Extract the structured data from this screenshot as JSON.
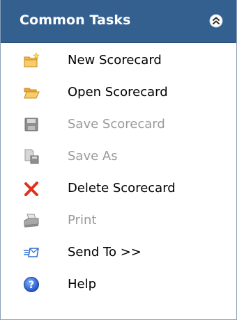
{
  "panel": {
    "title": "Common Tasks",
    "collapse_icon": "double-chevron-up-icon",
    "colors": {
      "header_bg": "#34608f",
      "header_text": "#ffffff",
      "enabled_text": "#000000",
      "disabled_text": "#9a9a9a"
    }
  },
  "tasks": [
    {
      "label": "New Scorecard",
      "icon": "new-folder-icon",
      "enabled": true
    },
    {
      "label": "Open Scorecard",
      "icon": "open-folder-icon",
      "enabled": true
    },
    {
      "label": "Save Scorecard",
      "icon": "save-disk-icon",
      "enabled": false
    },
    {
      "label": "Save As",
      "icon": "save-as-icon",
      "enabled": false
    },
    {
      "label": "Delete Scorecard",
      "icon": "delete-x-icon",
      "enabled": true
    },
    {
      "label": "Print",
      "icon": "printer-icon",
      "enabled": false
    },
    {
      "label": "Send To >>",
      "icon": "send-to-icon",
      "enabled": true
    },
    {
      "label": "Help",
      "icon": "help-icon",
      "enabled": true
    }
  ]
}
